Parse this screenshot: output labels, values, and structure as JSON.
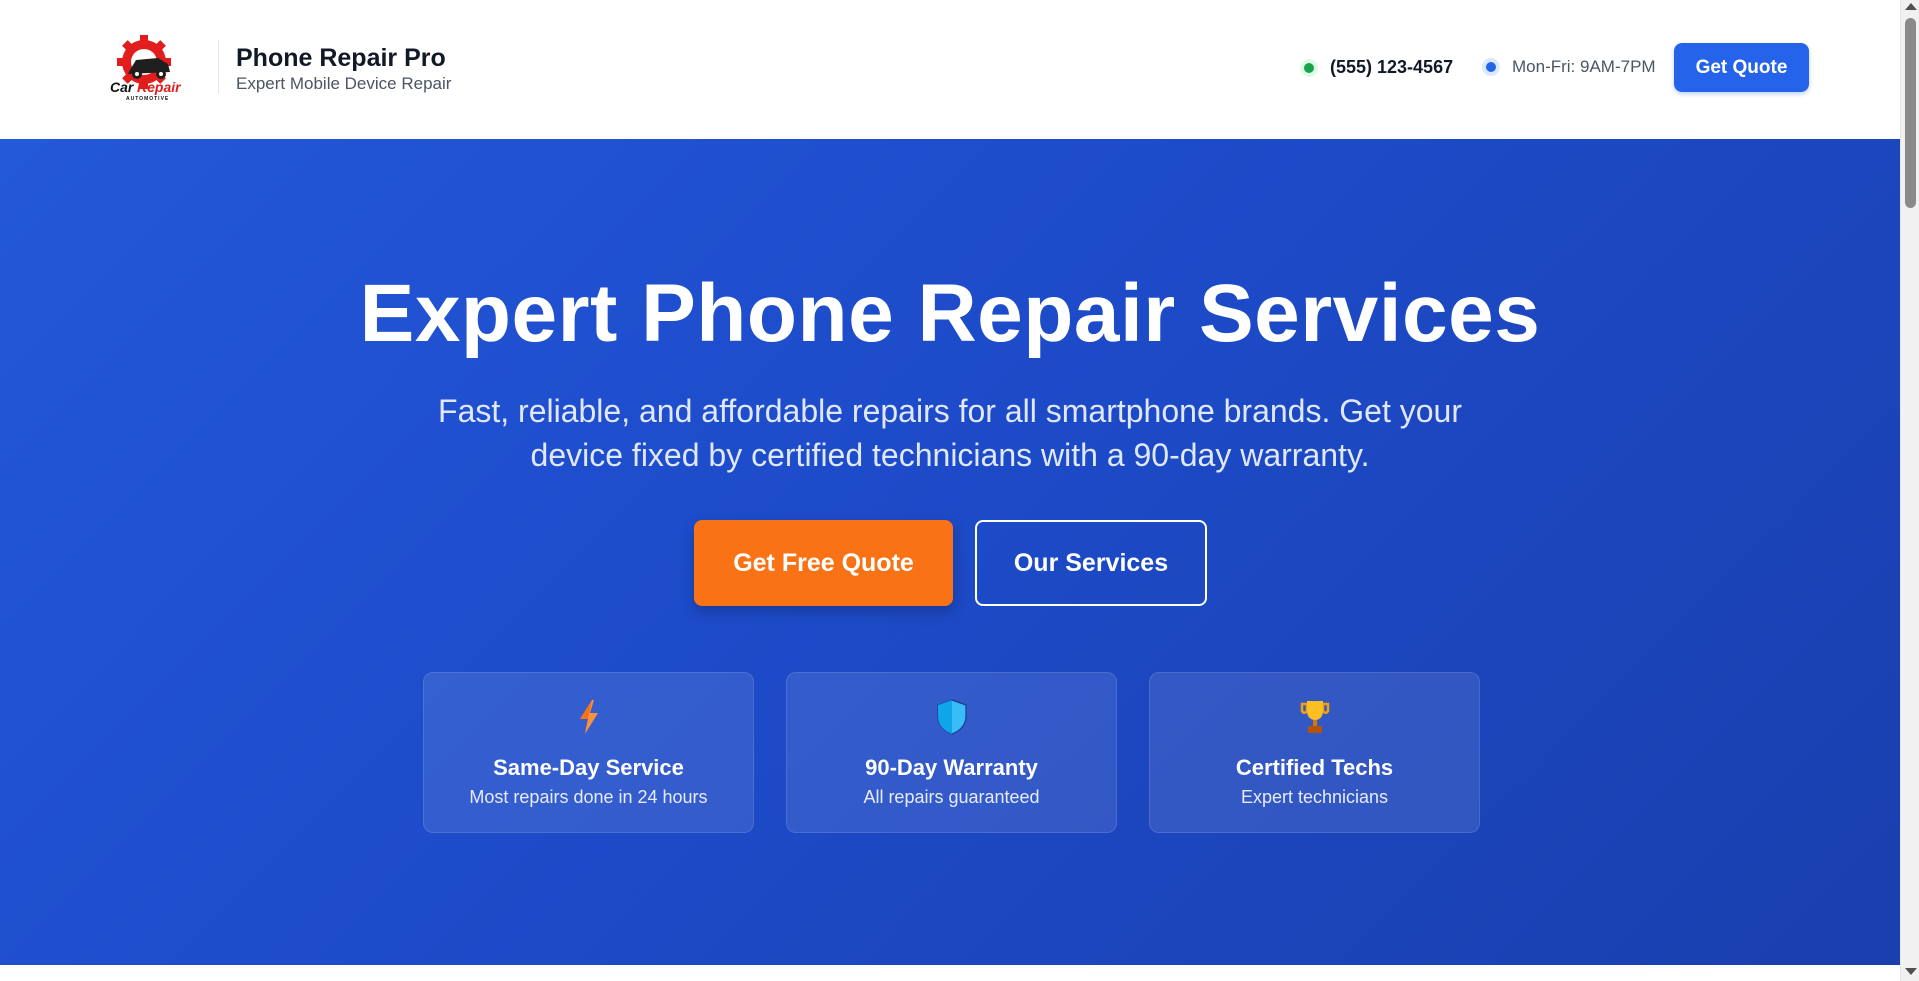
{
  "header": {
    "logo": {
      "wordmark_part1": "Car",
      "wordmark_part2": "Repair",
      "tagline": "AUTOMOTIVE",
      "icon": "gear-car-logo-icon"
    },
    "brand_title": "Phone Repair Pro",
    "brand_subtitle": "Expert Mobile Device Repair",
    "phone": "(555) 123-4567",
    "hours": "Mon-Fri: 9AM-7PM",
    "cta_label": "Get Quote"
  },
  "hero": {
    "title": "Expert Phone Repair Services",
    "subtitle": "Fast, reliable, and affordable repairs for all smartphone brands. Get your device fixed by certified technicians with a 90-day warranty.",
    "primary_button": "Get Free Quote",
    "secondary_button": "Our Services",
    "features": [
      {
        "icon": "lightning-bolt-icon",
        "title": "Same-Day Service",
        "description": "Most repairs done in 24 hours"
      },
      {
        "icon": "shield-icon",
        "title": "90-Day Warranty",
        "description": "All repairs guaranteed"
      },
      {
        "icon": "trophy-icon",
        "title": "Certified Techs",
        "description": "Expert technicians"
      }
    ]
  },
  "colors": {
    "primary_blue": "#2563eb",
    "hero_gradient_start": "#2358d9",
    "hero_gradient_end": "#1a3fae",
    "accent_orange": "#f97316",
    "status_green": "#16a34a",
    "logo_red": "#e11d1d"
  }
}
